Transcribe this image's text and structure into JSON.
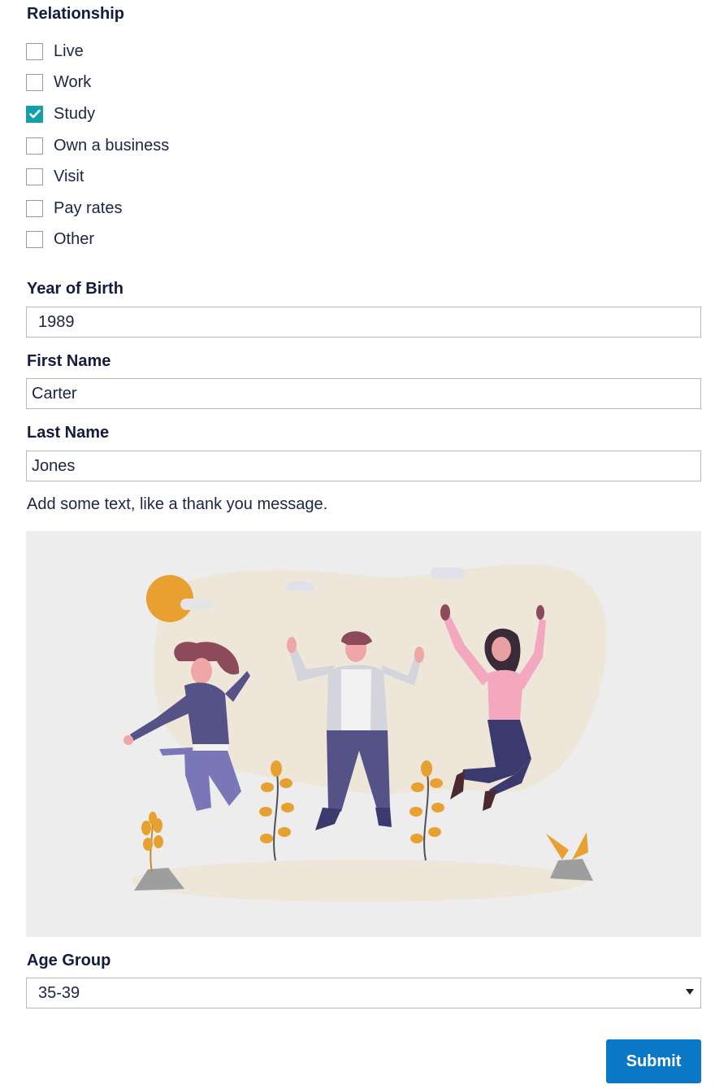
{
  "relationship": {
    "label": "Relationship",
    "options": [
      {
        "label": "Live",
        "checked": false
      },
      {
        "label": "Work",
        "checked": false
      },
      {
        "label": "Study",
        "checked": true
      },
      {
        "label": "Own a business",
        "checked": false
      },
      {
        "label": "Visit",
        "checked": false
      },
      {
        "label": "Pay rates",
        "checked": false
      },
      {
        "label": "Other",
        "checked": false
      }
    ]
  },
  "year_of_birth": {
    "label": "Year of Birth",
    "value": "1989"
  },
  "first_name": {
    "label": "First Name",
    "value": "Carter"
  },
  "last_name": {
    "label": "Last Name",
    "value": "Jones"
  },
  "message": "Add some text, like a thank you message.",
  "illustration": {
    "name": "people-celebrating-illustration"
  },
  "age_group": {
    "label": "Age Group",
    "selected": "35-39"
  },
  "submit_label": "Submit",
  "colors": {
    "accent_teal": "#14a0a8",
    "button_blue": "#0a78c6",
    "label_navy": "#141c3d"
  }
}
